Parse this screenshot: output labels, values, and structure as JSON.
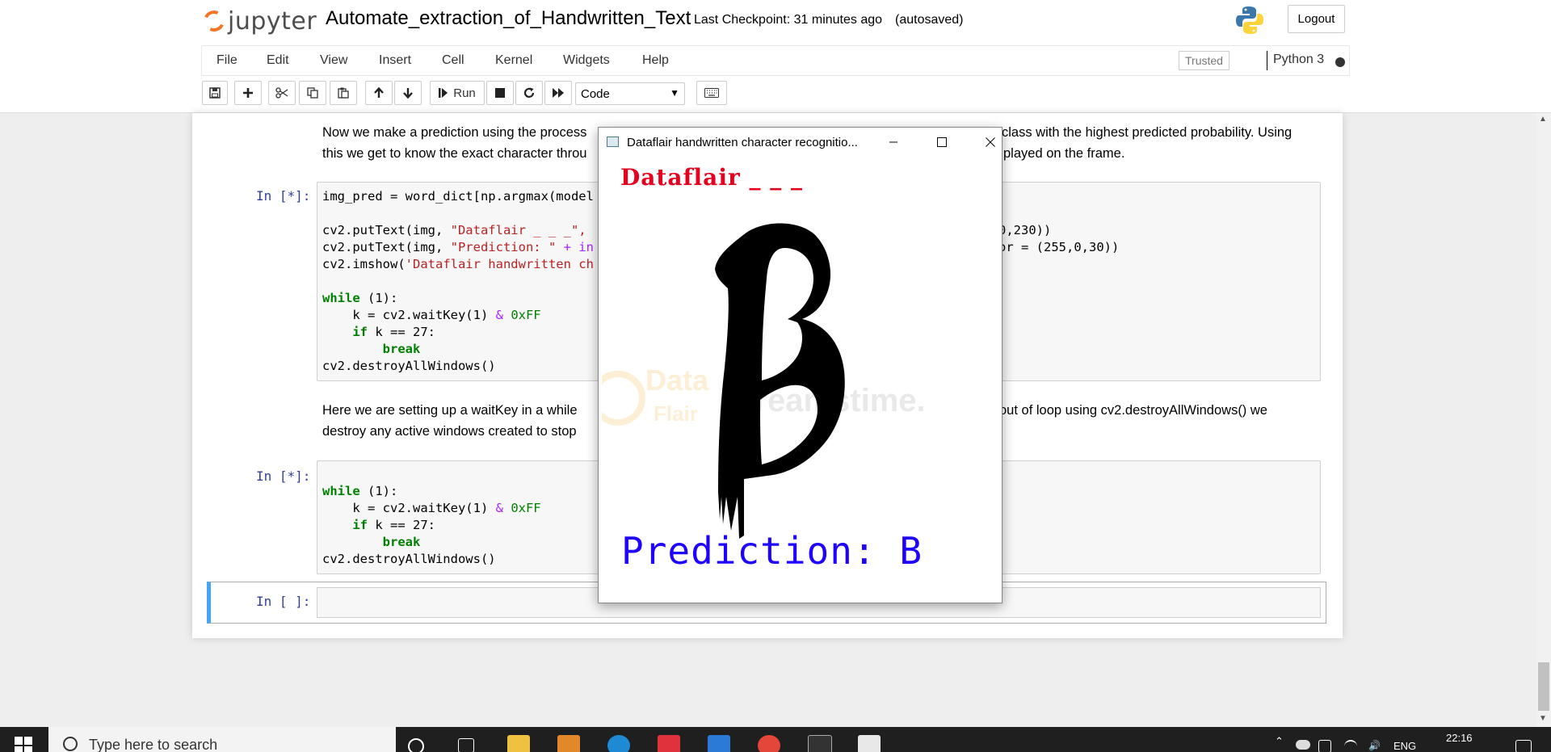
{
  "header": {
    "logo_text": "jupyter",
    "notebook_name": "Automate_extraction_of_Handwritten_Text",
    "checkpoint": "Last Checkpoint: 31 minutes ago",
    "autosave": "(autosaved)",
    "logout_label": "Logout"
  },
  "menu": {
    "items": [
      "File",
      "Edit",
      "View",
      "Insert",
      "Cell",
      "Kernel",
      "Widgets",
      "Help"
    ],
    "trusted_label": "Trusted",
    "kernel_name": "Python 3"
  },
  "toolbar": {
    "run_label": "Run",
    "cell_type": "Code",
    "icons": [
      "save-icon",
      "plus-icon",
      "cut-icon",
      "copy-icon",
      "paste-icon",
      "arrow-up-icon",
      "arrow-down-icon",
      "run-icon",
      "stop-icon",
      "restart-icon",
      "fast-forward-icon",
      "keyboard-icon"
    ]
  },
  "cells": {
    "md1_line1": "Now we make a prediction using the process",
    "md1_line1_tail": "class with the highest predicted probability. Using",
    "md1_line2": "this we get to know the exact character throu",
    "md1_line2_tail": "played on the frame.",
    "prompt1": "In [*]:",
    "code1": {
      "l1": "img_pred = word_dict[np.argmax(model",
      "l3a": "cv2.putText(img, ",
      "l3b": "\"Dataflair _ _ _\",",
      "l3c": "0,230))",
      "l4a": "cv2.putText(img, ",
      "l4b": "\"Prediction: \"",
      "l4c": " + in",
      "l4d": "or = (255,0,30))",
      "l5a": "cv2.imshow(",
      "l5b": "'Dataflair handwritten ch",
      "while": "while",
      "while_rest": " (1):",
      "k_line_a": "    k = cv2.waitKey(1) ",
      "k_line_b": "&",
      "k_line_c": " 0xFF",
      "if": "    if",
      "if_rest": " k == 27:",
      "break": "        break",
      "destroy": "cv2.destroyAllWindows()"
    },
    "md2_line1": "Here we are setting up a waitKey in a while",
    "md2_line1_tail": "out of loop using cv2.destroyAllWindows() we",
    "md2_line2": "destroy any active windows created to stop",
    "prompt2": "In [*]:",
    "prompt3": "In [ ]:"
  },
  "cv_window": {
    "title": "Dataflair handwritten character recognitio...",
    "top_text": "Dataflair _ _ _",
    "prediction_text": "Prediction: B",
    "watermark_text_1": "Data",
    "watermark_text_2": "Flair",
    "watermark_text_3": "dreamstime."
  },
  "taskbar": {
    "search_placeholder": "Type here to search",
    "language": "ENG",
    "time": "22:16"
  },
  "colors": {
    "cv_top_text": "#e6001e",
    "cv_prediction_text": "#1e00ff",
    "jupyter_orange": "#f37626",
    "selected_cell_border": "#42a5f5",
    "prompt_blue": "#303f9f"
  }
}
